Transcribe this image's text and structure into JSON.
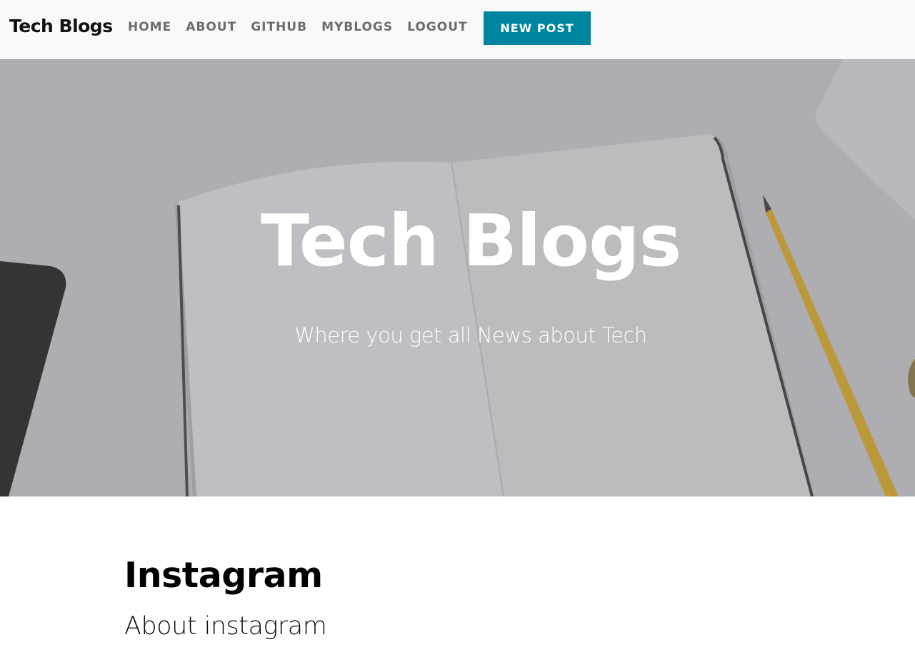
{
  "navbar": {
    "brand": "Tech Blogs",
    "links": [
      "HOME",
      "ABOUT",
      "GITHUB",
      "MYBLOGS",
      "LOGOUT"
    ],
    "new_post_label": "NEW POST",
    "new_post_color": "#0085a1"
  },
  "hero": {
    "title": "Tech Blogs",
    "subtitle": "Where you get all News about Tech"
  },
  "post": {
    "title": "Instagram",
    "subtitle": "About instagram"
  }
}
